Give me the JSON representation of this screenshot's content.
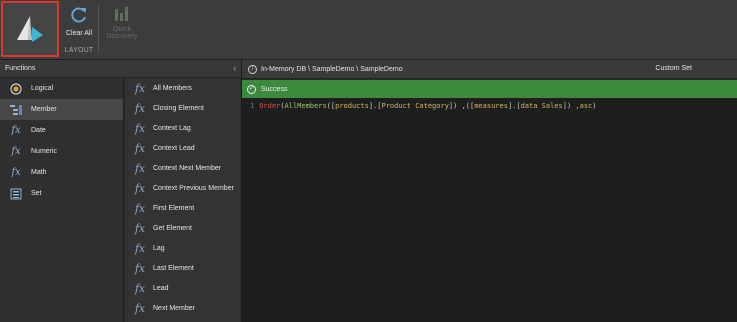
{
  "ribbon": {
    "clear_all_label": "Clear All",
    "quick_discovery_label_1": "Quick",
    "quick_discovery_label_2": "Discovery",
    "group_label": "LAYOUT"
  },
  "functions_panel": {
    "title": "Functions",
    "categories": [
      {
        "label": "Logical",
        "icon": "logical-icon"
      },
      {
        "label": "Member",
        "icon": "member-icon"
      },
      {
        "label": "Date",
        "icon": "date-fx-icon"
      },
      {
        "label": "Numeric",
        "icon": "numeric-fx-icon"
      },
      {
        "label": "Math",
        "icon": "math-fx-icon"
      },
      {
        "label": "Set",
        "icon": "set-icon"
      }
    ],
    "selected_category": "Member",
    "functions": [
      "All Members",
      "Closing Element",
      "Context Lag",
      "Context Lead",
      "Context Next Member",
      "Context Previous Member",
      "First Element",
      "Get Element",
      "Lag",
      "Last Element",
      "Lead",
      "Next Member"
    ],
    "fx_glyph": "fx"
  },
  "editor": {
    "path": "In-Memory DB \\ SampleDemo \\ SampleDemo",
    "type": "Custom Set",
    "status": "Success",
    "line_number": "1",
    "code_tokens": {
      "t1": "Order",
      "t2": "(",
      "t3": "AllMembers",
      "t4": "([",
      "t5": "products",
      "t6": "].[",
      "t7": "Product Category",
      "t8": "]) ,([",
      "t9": "measures",
      "t10": "].[",
      "t11": "data Sales",
      "t12": "]) ,",
      "t13": "asc",
      "t14": ")"
    }
  },
  "colors": {
    "accent_red": "#d9382f",
    "success_green": "#3b8a3e",
    "logo_teal": "#3fb6d9"
  }
}
